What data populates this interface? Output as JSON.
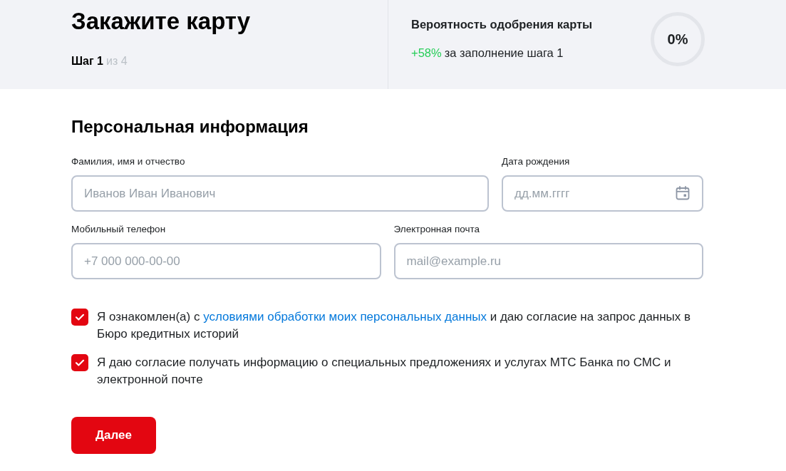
{
  "header": {
    "title": "Закажите карту",
    "step": {
      "current": "Шаг 1",
      "total": "из 4"
    }
  },
  "approval": {
    "title": "Вероятность одобрения карты",
    "bonus": "+58%",
    "bonus_text": "за заполнение шага 1",
    "value": "0%"
  },
  "form": {
    "title": "Персональная информация",
    "fields": [
      {
        "label": "Фамилия, имя и отчество",
        "placeholder": "Иванов Иван Иванович",
        "kind": "text"
      },
      {
        "label": "Дата рождения",
        "placeholder": "дд.мм.гггг",
        "kind": "date"
      },
      {
        "label": "Мобильный телефон",
        "placeholder": "+7 000 000-00-00",
        "kind": "text"
      },
      {
        "label": "Электронная почта",
        "placeholder": "mail@example.ru",
        "kind": "text"
      }
    ],
    "consents": [
      {
        "text_before": "Я ознакомлен(а) с",
        "link": "условиями обработки моих персональных данных",
        "text_after": "и даю согласие на запрос данных в Бюро кредитных историй",
        "checked": true
      },
      {
        "text_before": "Я даю согласие получать информацию о специальных предложениях и услугах МТС Банка по СМС и электронной почте",
        "checked": true
      }
    ],
    "submit": "Далее"
  }
}
